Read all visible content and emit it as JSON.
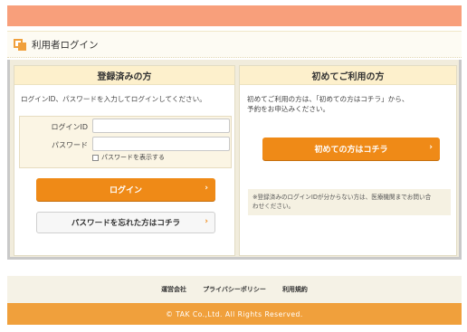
{
  "page": {
    "title": "利用者ログイン",
    "title_icon": "window-stack-icon"
  },
  "registered": {
    "heading": "登録済みの方",
    "description": "ログインID、パスワードを入力してログインしてください。",
    "login_id_label": "ログインID",
    "login_id_value": "",
    "password_label": "パスワード",
    "password_value": "",
    "show_password_label": "パスワードを表示する",
    "login_button": "ログイン",
    "forgot_button": "パスワードを忘れた方はコチラ"
  },
  "first_time": {
    "heading": "初めてご利用の方",
    "description_line1": "初めてご利用の方は、「初めての方はコチラ」から、",
    "description_line2": "予約をお申込みください。",
    "button": "初めての方はコチラ",
    "note_line1": "※登録済みのログインIDが分からない方は、医療機関までお問い合",
    "note_line2": "わせください。"
  },
  "footer": {
    "links": [
      "運営会社",
      "プライバシーポリシー",
      "利用規約"
    ],
    "copyright": "© TAK Co.,Ltd. All Rights Reserved."
  },
  "colors": {
    "accent": "#ef8a17",
    "header_bar": "#f89f7b",
    "footer_bar": "#f0a03c"
  }
}
